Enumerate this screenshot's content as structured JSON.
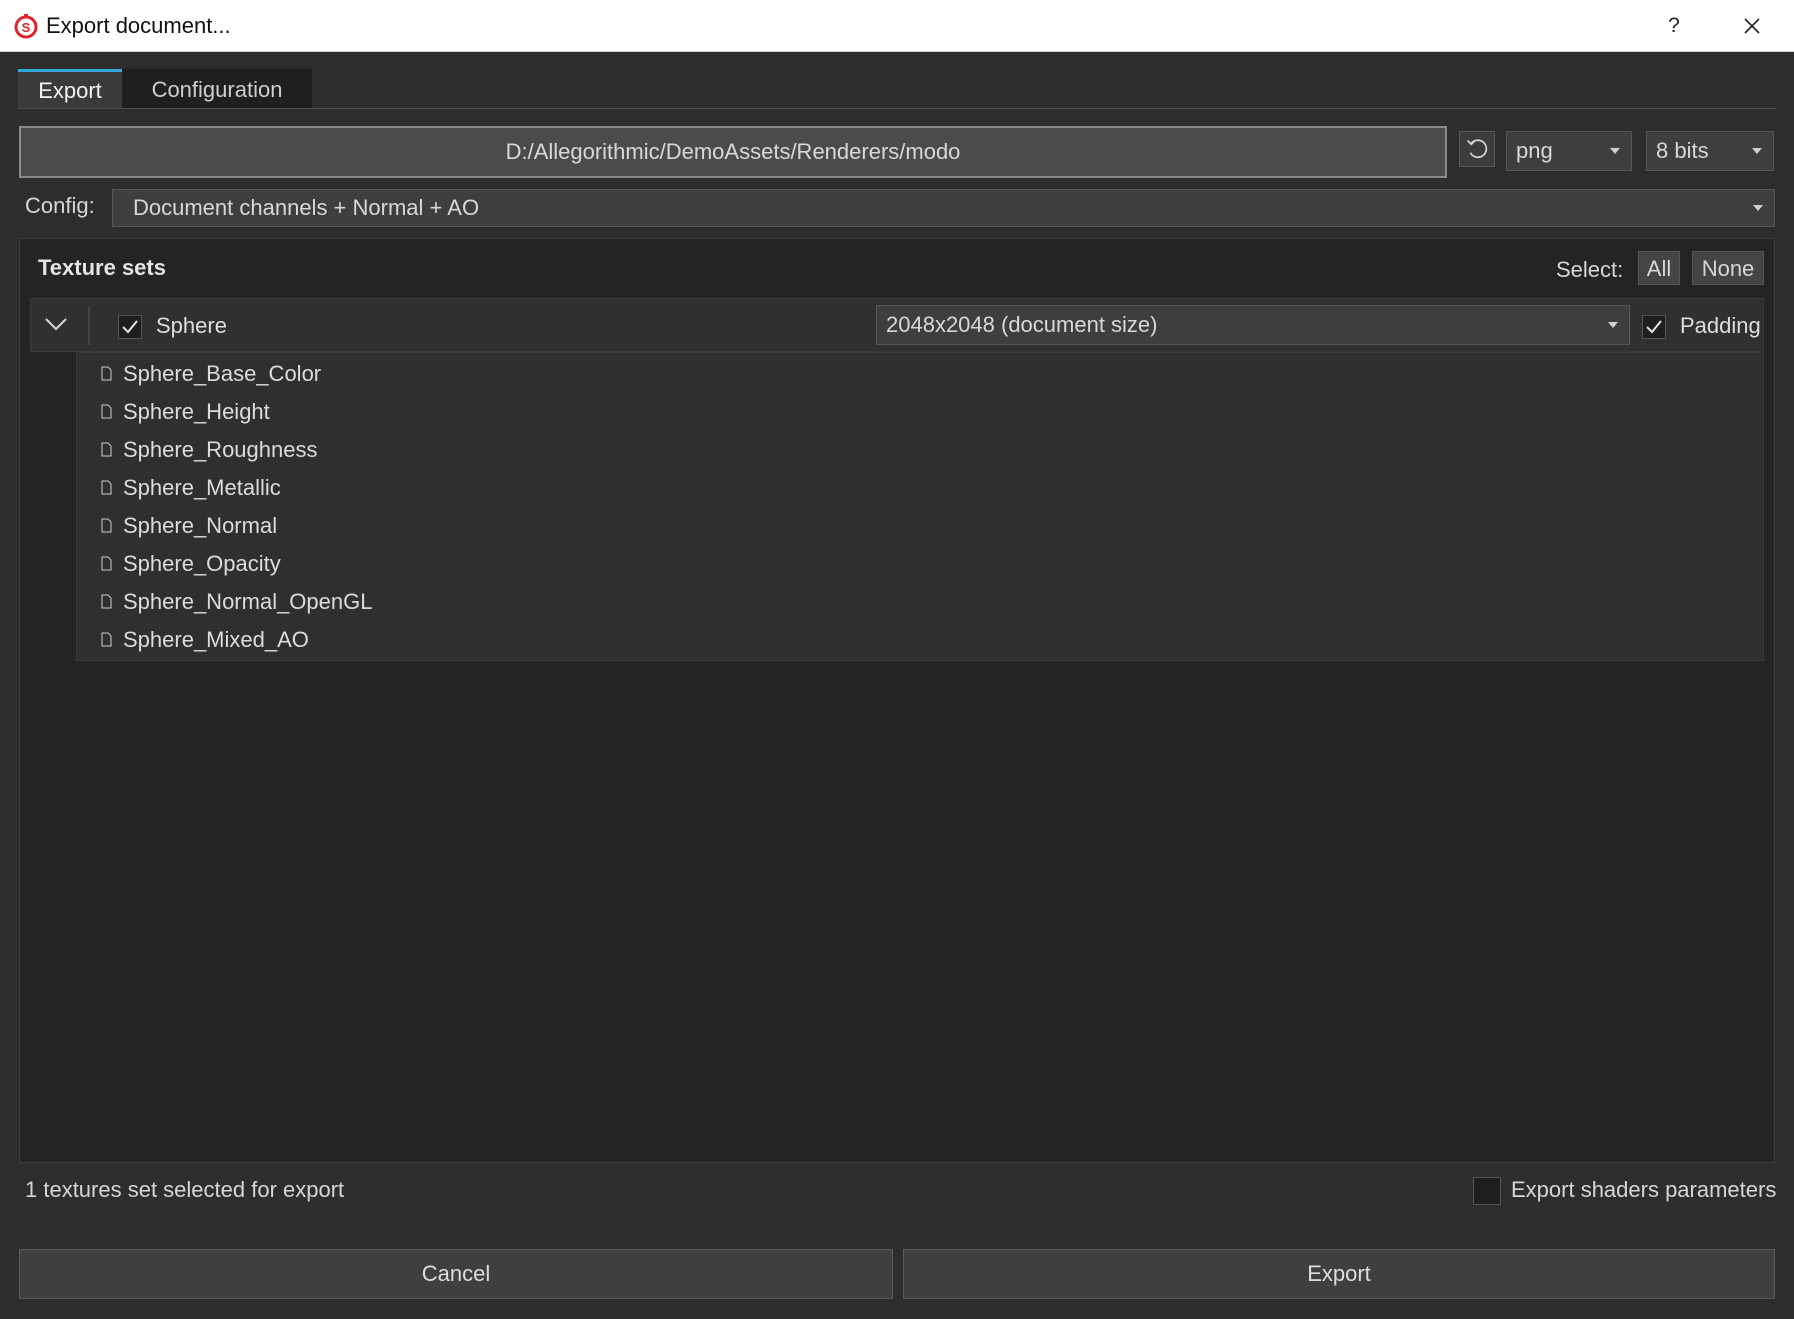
{
  "window": {
    "title": "Export document...",
    "help_label": "?"
  },
  "tabs": [
    {
      "label": "Export",
      "active": true
    },
    {
      "label": "Configuration",
      "active": false
    }
  ],
  "export": {
    "path": "D:/Allegorithmic/DemoAssets/Renderers/modo",
    "format": "png",
    "bit_depth": "8 bits",
    "config_label": "Config:",
    "config_value": "Document channels + Normal + AO"
  },
  "texture_sets": {
    "title": "Texture sets",
    "select_label": "Select:",
    "all_label": "All",
    "none_label": "None",
    "sets": [
      {
        "name": "Sphere",
        "checked": true,
        "size": "2048x2048 (document size)",
        "padding_label": "Padding",
        "padding_checked": true,
        "textures": [
          "Sphere_Base_Color",
          "Sphere_Height",
          "Sphere_Roughness",
          "Sphere_Metallic",
          "Sphere_Normal",
          "Sphere_Opacity",
          "Sphere_Normal_OpenGL",
          "Sphere_Mixed_AO"
        ]
      }
    ]
  },
  "footer": {
    "status": "1 textures set selected for export",
    "export_shaders_label": "Export shaders parameters",
    "export_shaders_checked": false,
    "cancel_label": "Cancel",
    "export_label": "Export"
  },
  "colors": {
    "accent": "#33a8d8",
    "logo_red": "#e0242e",
    "background": "#2d2d2d",
    "panel": "#242424"
  }
}
